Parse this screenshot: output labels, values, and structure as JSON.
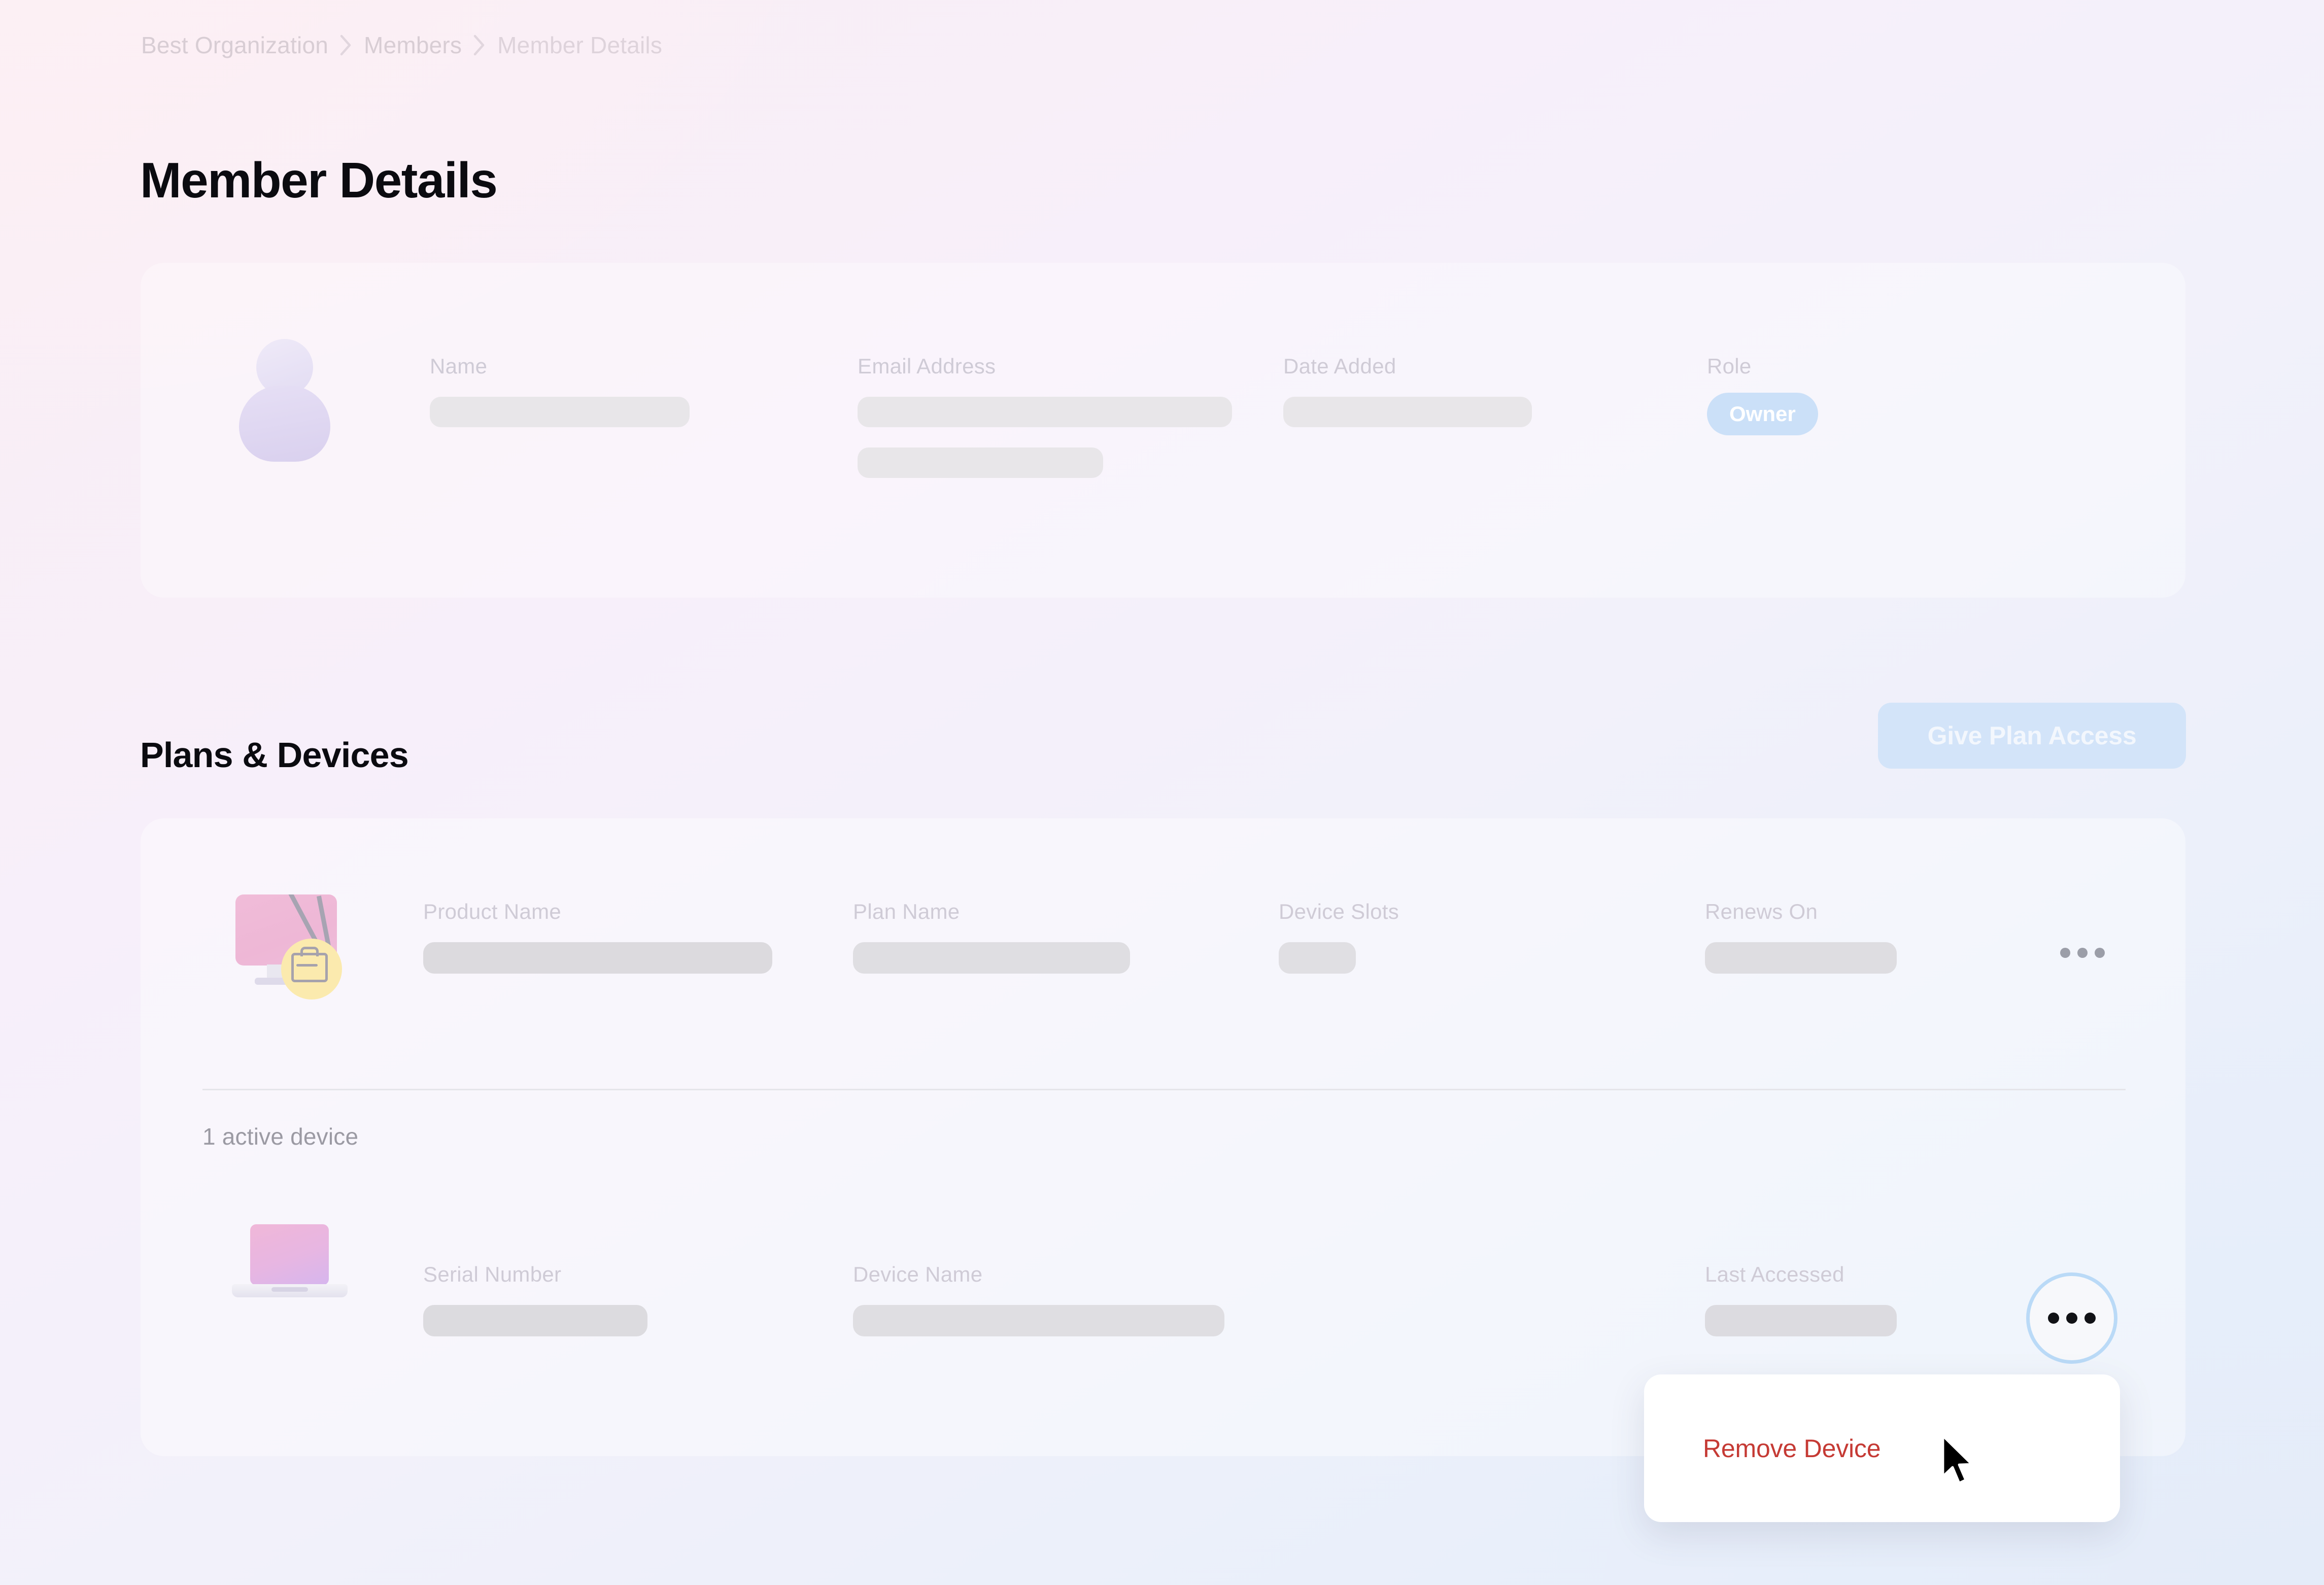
{
  "breadcrumb": {
    "items": [
      {
        "label": "Best Organization"
      },
      {
        "label": "Members"
      },
      {
        "label": "Member Details"
      }
    ],
    "separator": "chevron-right-icon"
  },
  "page": {
    "title": "Member Details"
  },
  "member_card": {
    "avatar_icon": "user-avatar-icon",
    "fields": [
      {
        "label": "Name",
        "value": "",
        "placeholder_widths": [
          176
        ]
      },
      {
        "label": "Email Address",
        "value": "",
        "placeholder_widths": [
          253,
          166
        ]
      },
      {
        "label": "Date Added",
        "value": "",
        "placeholder_widths": [
          167
        ]
      },
      {
        "label": "Role",
        "value": "Owner"
      }
    ],
    "role_badge": {
      "text": "Owner",
      "background": "#cbe0f8",
      "color": "#ffffff"
    }
  },
  "plans_section": {
    "title": "Plans & Devices",
    "give_plan_access_button": {
      "label": "Give Plan Access",
      "background": "#d3e4f9",
      "color": "#f3f7fd"
    },
    "plan_row": {
      "icon": "desktop-monitor-briefcase-icon",
      "columns": [
        {
          "label": "Product Name",
          "value": ""
        },
        {
          "label": "Plan Name",
          "value": ""
        },
        {
          "label": "Device Slots",
          "value": ""
        },
        {
          "label": "Renews On",
          "value": ""
        }
      ],
      "menu_icon": "ellipsis-horizontal-icon"
    },
    "devices": {
      "count_text": "1 active device",
      "row": {
        "icon": "laptop-icon",
        "columns": [
          {
            "label": "Serial Number",
            "value": ""
          },
          {
            "label": "Device Name",
            "value": ""
          },
          {
            "label": "Last Accessed",
            "value": ""
          }
        ],
        "menu_icon": "ellipsis-horizontal-icon"
      }
    }
  },
  "dropdown_menu": {
    "open": true,
    "items": [
      {
        "label": "Remove Device",
        "color": "#c53a34"
      }
    ]
  },
  "colors": {
    "background_start": "#faeef3",
    "background_end": "#e7eefa",
    "accent_blue": "#cbe0f8",
    "danger_red": "#c53a34",
    "label_gray": "#cfcbd6",
    "placeholder_gray": "#e8e6e9"
  },
  "cursor": {
    "icon": "mouse-pointer-icon"
  }
}
